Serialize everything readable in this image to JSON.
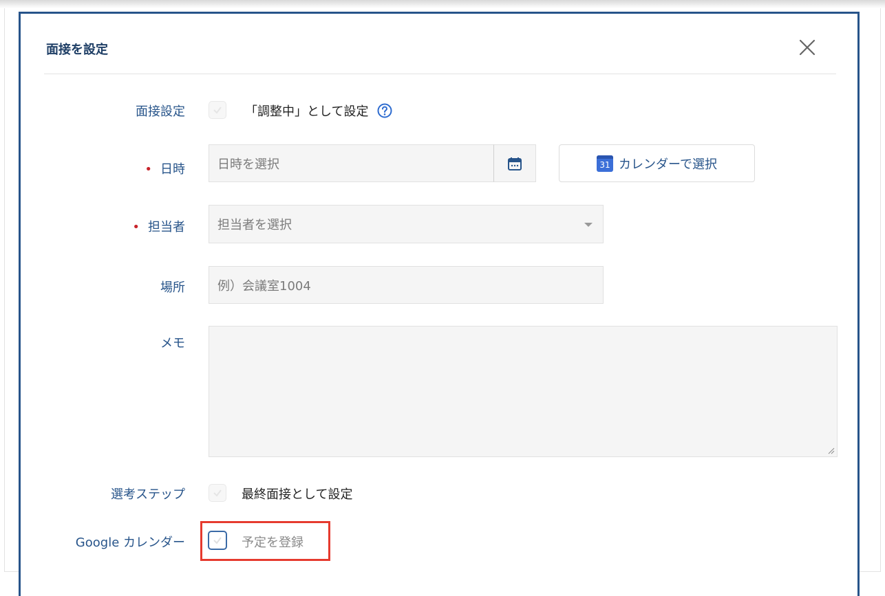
{
  "modal": {
    "title": "面接を設定",
    "close_icon": "close-icon"
  },
  "form": {
    "interview_setting": {
      "label": "面接設定",
      "checkbox_text": "「調整中」として設定",
      "help_icon": "question-circle-icon"
    },
    "datetime": {
      "label": "日時",
      "required": true,
      "placeholder": "日時を選択",
      "calendar_icon": "calendar-icon",
      "calendar_button_label": "カレンダーで選択",
      "calendar_button_icon_text": "31"
    },
    "assignee": {
      "label": "担当者",
      "required": true,
      "placeholder": "担当者を選択",
      "dropdown_icon": "caret-down-icon"
    },
    "location": {
      "label": "場所",
      "placeholder": "例）会議室1004"
    },
    "memo": {
      "label": "メモ",
      "value": ""
    },
    "selection_step": {
      "label": "選考ステップ",
      "checkbox_text": "最終面接として設定"
    },
    "google_calendar": {
      "label": "Google カレンダー",
      "checkbox_text": "予定を登録"
    }
  },
  "colors": {
    "modal_border": "#27548a",
    "label_text": "#27548a",
    "required_dot": "#c8242b",
    "highlight_box": "#e63a2e"
  }
}
